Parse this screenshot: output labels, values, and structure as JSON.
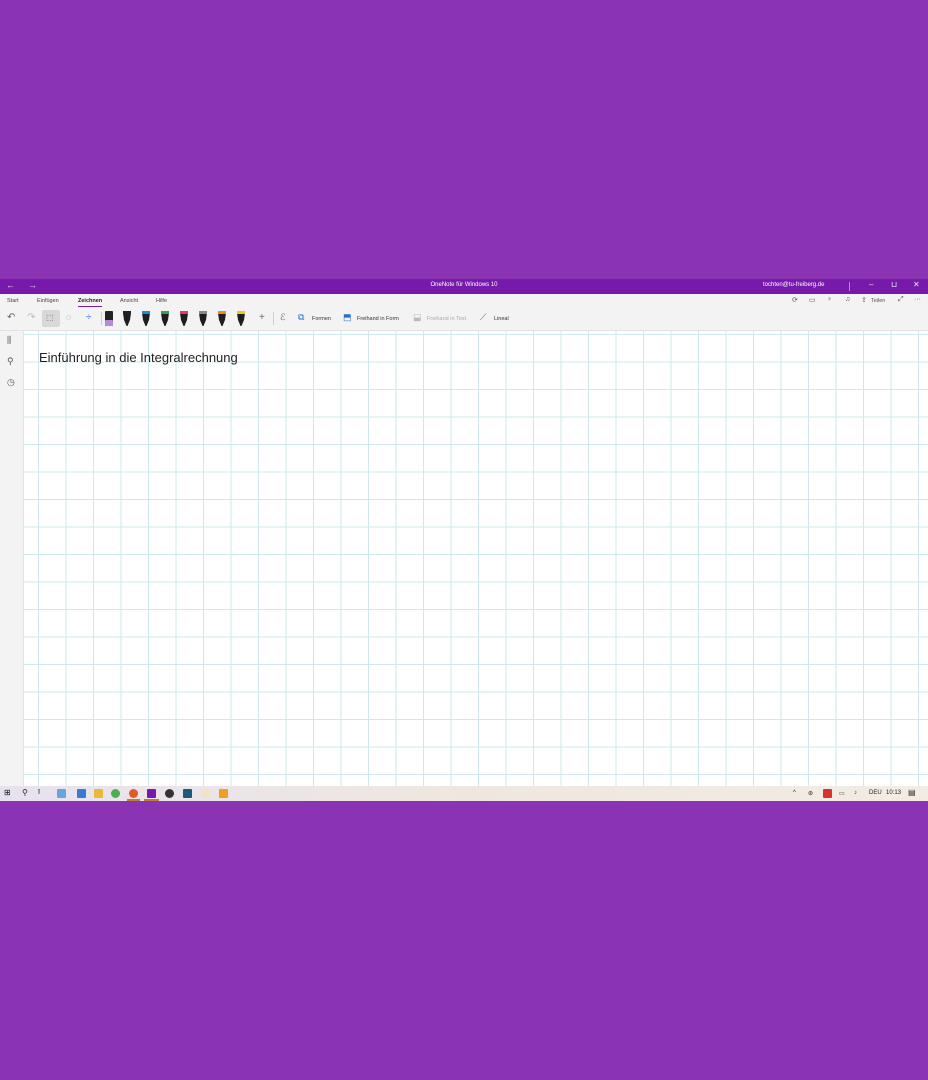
{
  "window": {
    "title": "OneNote für Windows 10",
    "account": "tochten@tu-freiberg.de",
    "back_icon": "←",
    "forward_icon": "→",
    "minimize": "–",
    "restore": "⊔",
    "close": "✕"
  },
  "menu": {
    "tabs": [
      "Start",
      "Einfügen",
      "Zeichnen",
      "Ansicht",
      "Hilfe"
    ],
    "active": "Zeichnen",
    "share_label": "Teilen"
  },
  "toolbar": {
    "shapes_label": "Formen",
    "ink_to_shape_label": "Freihand in Form",
    "ink_to_text_label": "Freihand in Text",
    "ruler_label": "Lineal",
    "pens": [
      {
        "name": "pen-black",
        "color": "#222222"
      },
      {
        "name": "pen-blue",
        "color": "#1f8ad6"
      },
      {
        "name": "pen-green",
        "color": "#2da64a"
      },
      {
        "name": "highlighter-pink",
        "color": "#e8307a"
      },
      {
        "name": "pencil-gray",
        "color": "#888888"
      },
      {
        "name": "pen-orange",
        "color": "#f08a24"
      },
      {
        "name": "pen-yellow",
        "color": "#f2c80f"
      }
    ]
  },
  "page": {
    "title": "Einführung in die Integralrechnung"
  },
  "taskbar": {
    "language": "DEU",
    "time": "10:13"
  }
}
